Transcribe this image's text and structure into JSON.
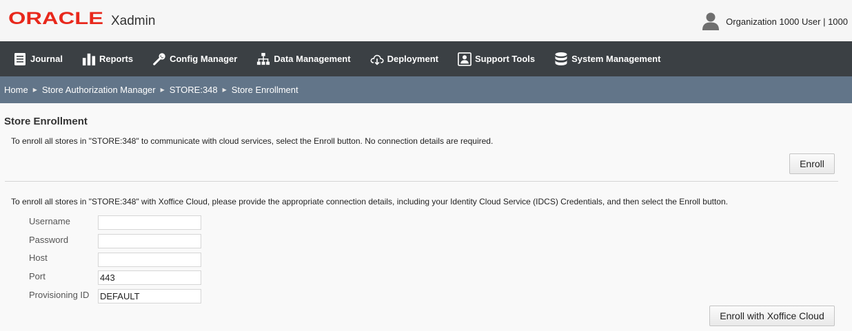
{
  "header": {
    "logo_text": "ORACLE",
    "app_name": "Xadmin",
    "user_name": "Organization 1000 User | 1000"
  },
  "nav": {
    "items": [
      {
        "label": "Journal",
        "icon": "journal-icon"
      },
      {
        "label": "Reports",
        "icon": "bar-chart-icon"
      },
      {
        "label": "Config Manager",
        "icon": "wrench-icon"
      },
      {
        "label": "Data Management",
        "icon": "hierarchy-icon"
      },
      {
        "label": "Deployment",
        "icon": "cloud-download-icon"
      },
      {
        "label": "Support Tools",
        "icon": "support-icon"
      },
      {
        "label": "System Management",
        "icon": "database-icon"
      }
    ]
  },
  "breadcrumb": [
    "Home",
    "Store Authorization Manager",
    "STORE:348",
    "Store Enrollment"
  ],
  "main": {
    "title": "Store Enrollment",
    "info_enroll": "To enroll all stores in \"STORE:348\" to communicate with cloud services, select the Enroll button. No connection details are required.",
    "enroll_button": "Enroll",
    "info_cloud": "To enroll all stores in \"STORE:348\" with Xoffice Cloud, please provide the appropriate connection details, including your Identity Cloud Service (IDCS) Credentials, and then select the Enroll button.",
    "form": {
      "username": {
        "label": "Username",
        "value": ""
      },
      "password": {
        "label": "Password",
        "value": ""
      },
      "host": {
        "label": "Host",
        "value": ""
      },
      "port": {
        "label": "Port",
        "value": "443"
      },
      "provisioning_id": {
        "label": "Provisioning ID",
        "value": "DEFAULT"
      }
    },
    "cloud_button": "Enroll with Xoffice Cloud"
  },
  "colors": {
    "oracle_red": "#e8281c",
    "nav_bg": "#3b4044",
    "breadcrumb_bg": "#627589"
  }
}
